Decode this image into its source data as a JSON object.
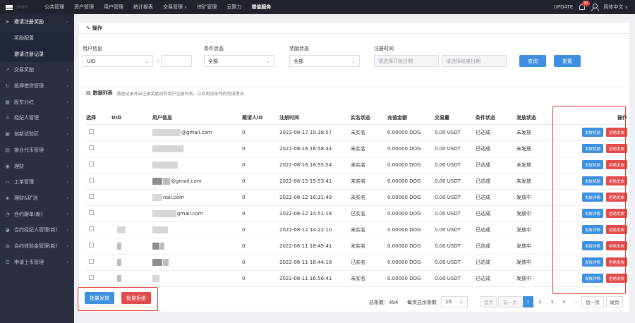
{
  "topbar": {
    "logo_text": "SMIMI",
    "nav": [
      "公共管理",
      "资产管理",
      "用户管理",
      "统计报表",
      "交易管理",
      "挖矿管理",
      "云算力",
      "增值服务"
    ],
    "active": "增值服务",
    "update": "UPDATE",
    "badge": "63",
    "language": "简体中文"
  },
  "sidebar": {
    "items": [
      {
        "label": "邀请注册奖励",
        "icon": "send-icon",
        "open": true
      },
      {
        "label": "交易奖励",
        "icon": "chart-icon"
      },
      {
        "label": "抵押借贷管理",
        "icon": "refresh-icon"
      },
      {
        "label": "股东分红",
        "icon": "grid-icon"
      },
      {
        "label": "经纪人管理",
        "icon": "user-icon"
      },
      {
        "label": "创新试验区",
        "icon": "box-icon"
      },
      {
        "label": "锁仓代币管理",
        "icon": "lock-icon"
      },
      {
        "label": "理财",
        "icon": "coin-icon"
      },
      {
        "label": "工单管理",
        "icon": "ticket-icon"
      },
      {
        "label": "理财&矿池",
        "icon": "pool-icon"
      },
      {
        "label": "合约跟单(新)",
        "icon": "copy-icon"
      },
      {
        "label": "合约经纪人管理(新)",
        "icon": "broker-icon"
      },
      {
        "label": "合约体验金管理(新)",
        "icon": "wallet-icon"
      },
      {
        "label": "申请上币管理",
        "icon": "list-icon"
      }
    ],
    "subitems": [
      "奖励配置",
      "邀请注册记录"
    ],
    "active_sub": "邀请注册记录"
  },
  "filter": {
    "title": "操作",
    "user_info_label": "用户信息",
    "user_info_select": "UID",
    "user_info_dash": "-",
    "cond_label": "条件状态",
    "cond_value": "全部",
    "reward_label": "奖励状态",
    "reward_value": "全部",
    "reg_time_label": "注册时间",
    "start_ph": "请选择开始日期",
    "end_ph": "请选择结束日期",
    "query": "查询",
    "reset": "重置"
  },
  "list": {
    "title": "数据列表",
    "subtitle": "数据记录开启注册奖励后的用户注册列表，以及附加条件的完成情况",
    "headers": [
      "选择",
      "UID",
      "用户信息",
      "邀请人ID",
      "注册时间",
      "实名状态",
      "充值金额",
      "交易量",
      "条件状态",
      "发放状态",
      "操作"
    ],
    "rows": [
      {
        "email": "@gmail.com",
        "inviter": "0",
        "time": "2022-08-17 10:38:57",
        "kyc": "未实名",
        "deposit": "0.00000 DOG",
        "volume": "0.00 USDT",
        "cond": "已达成",
        "status": "未发放",
        "btn1": "发放奖励",
        "btn2": "拒绝发放"
      },
      {
        "email": "",
        "inviter": "0",
        "time": "2022-08-16 16:58:44",
        "kyc": "未实名",
        "deposit": "0.00000 DOG",
        "volume": "0.00 USDT",
        "cond": "已达成",
        "status": "未发放",
        "btn1": "发放奖励",
        "btn2": "拒绝发放"
      },
      {
        "email": "",
        "inviter": "0",
        "time": "2022-08-16 16:55:54",
        "kyc": "未实名",
        "deposit": "0.00000 DOG",
        "volume": "0.00 USDT",
        "cond": "已达成",
        "status": "未发放",
        "btn1": "发放奖励",
        "btn2": "拒绝发放"
      },
      {
        "email": "@gmail.com",
        "inviter": "0",
        "time": "2022-08-15 19:53:41",
        "kyc": "未实名",
        "deposit": "0.00000 DOG",
        "volume": "0.00 USDT",
        "cond": "已达成",
        "status": "未发放",
        "btn1": "发放奖励",
        "btn2": "拒绝发放"
      },
      {
        "email": "nail.com",
        "inviter": "0",
        "time": "2022-08-12 16:31:49",
        "kyc": "未实名",
        "deposit": "0.00000 DOG",
        "volume": "0.00 USDT",
        "cond": "已达成",
        "status": "发放中",
        "btn1": "发放详情",
        "btn2": "拒绝发放"
      },
      {
        "email": "gmail.com",
        "inviter": "0",
        "time": "2022-08-12 14:51:18",
        "kyc": "已实名",
        "deposit": "0.00000 DOG",
        "volume": "0.00 USDT",
        "cond": "已达成",
        "status": "发放中",
        "btn1": "发放详情",
        "btn2": "拒绝发放"
      },
      {
        "email": "",
        "inviter": "0",
        "time": "2022-08-12 14:22:10",
        "kyc": "未实名",
        "deposit": "0.00000 DOG",
        "volume": "0.00 USDT",
        "cond": "已达成",
        "status": "发放中",
        "btn1": "发放详情",
        "btn2": "拒绝发放"
      },
      {
        "email": "",
        "inviter": "0",
        "time": "2022-08-11 18:45:41",
        "kyc": "未实名",
        "deposit": "0.00000 DOG",
        "volume": "0.00 USDT",
        "cond": "已达成",
        "status": "发放中",
        "btn1": "发放详情",
        "btn2": "拒绝发放"
      },
      {
        "email": "",
        "inviter": "0",
        "time": "2022-08-11 18:44:18",
        "kyc": "已实名",
        "deposit": "0.00000 DOG",
        "volume": "0.00 USDT",
        "cond": "已达成",
        "status": "发放中",
        "btn1": "发放详情",
        "btn2": "拒绝发放"
      },
      {
        "email": "",
        "inviter": "0",
        "time": "2022-08-11 16:56:41",
        "kyc": "未实名",
        "deposit": "0.00000 DOG",
        "volume": "0.00 USDT",
        "cond": "已达成",
        "status": "发放中",
        "btn1": "发放详情",
        "btn2": "拒绝发放"
      }
    ]
  },
  "footer": {
    "batch_issue": "批量发放",
    "batch_reject": "批量拒绝",
    "total_label": "总条数：494",
    "page_size_label": "每页显示条数",
    "page_size": "10",
    "first": "首页",
    "prev": "前一页",
    "pages": [
      "1",
      "2",
      "3",
      "4"
    ],
    "ellipsis": "...",
    "next": "后一页",
    "last": "尾页"
  },
  "colors": {
    "primary": "#3d8fe0",
    "danger": "#e24b4b",
    "highlight": "#e33b2e",
    "sidebar": "#2b2f3f"
  }
}
